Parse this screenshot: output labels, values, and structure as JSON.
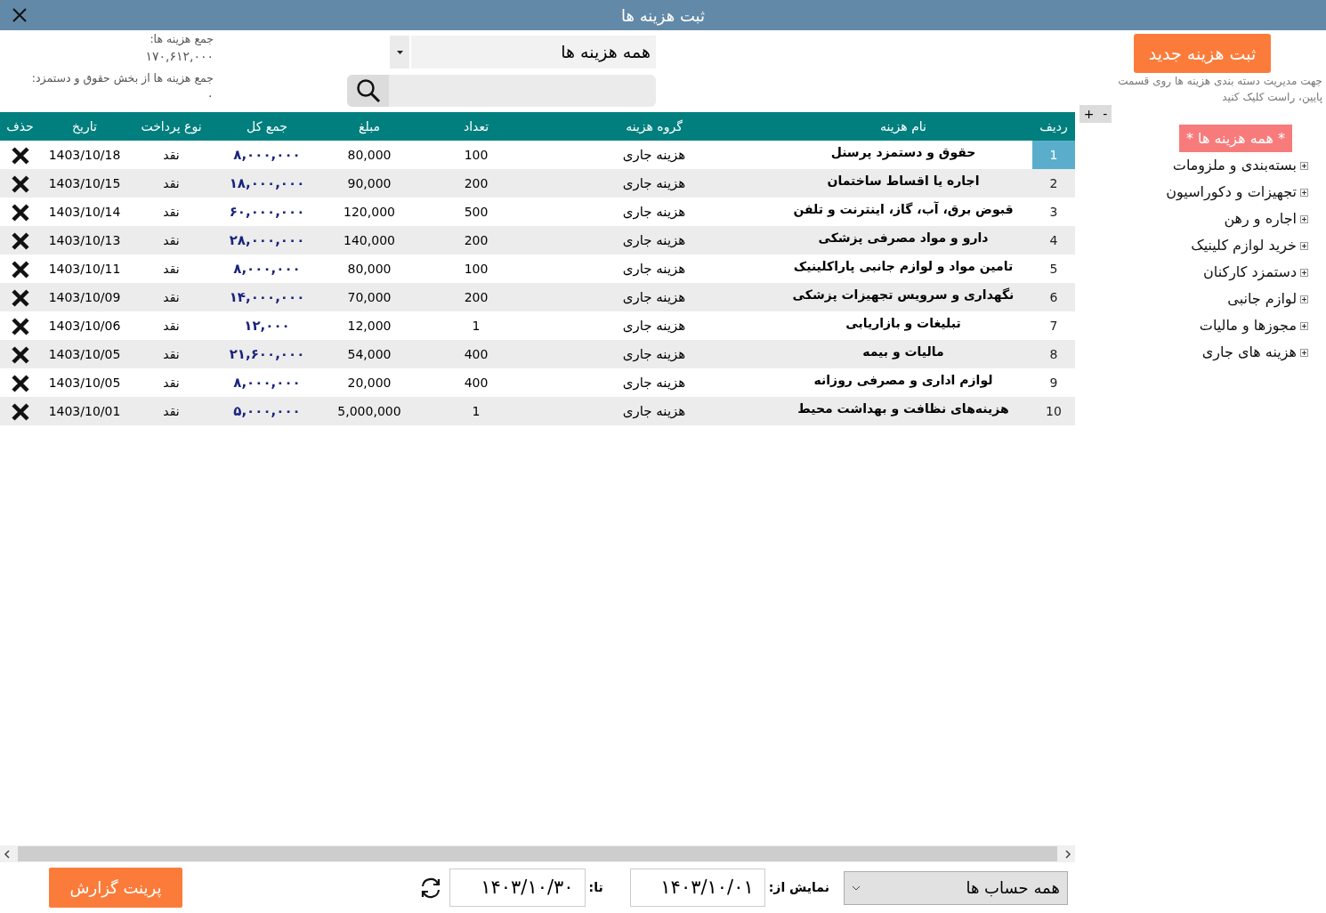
{
  "window": {
    "title": "ثبت هزینه ها"
  },
  "summary": [
    {
      "label": "جمع هزینه ها:",
      "value": "۱۷۰,۶۱۲,۰۰۰"
    },
    {
      "label": "جمع هزینه ها از بخش حقوق و دستمزد:",
      "value": "۰"
    }
  ],
  "filter": {
    "category": "همه هزینه ها"
  },
  "table": {
    "columns": [
      "ردیف",
      "نام هزینه",
      "گروه هزینه",
      "تعداد",
      "مبلغ",
      "جمع کل",
      "نوع پرداخت",
      "تاریخ",
      "حذف"
    ],
    "rows": [
      {
        "selected": true,
        "cells": [
          "1",
          "حقوق و دستمزد پرسنل",
          "هزینه جاری",
          "100",
          "80,000",
          "۸,۰۰۰,۰۰۰",
          "نقد",
          "1403/10/18"
        ]
      },
      {
        "selected": false,
        "cells": [
          "2",
          "اجاره یا اقساط ساختمان",
          "هزینه جاری",
          "200",
          "90,000",
          "۱۸,۰۰۰,۰۰۰",
          "نقد",
          "1403/10/15"
        ]
      },
      {
        "selected": false,
        "cells": [
          "3",
          "قبوض برق، آب، گاز، اینترنت و تلفن",
          "هزینه جاری",
          "500",
          "120,000",
          "۶۰,۰۰۰,۰۰۰",
          "نقد",
          "1403/10/14"
        ]
      },
      {
        "selected": false,
        "cells": [
          "4",
          "دارو و مواد مصرفی پزشکی",
          "هزینه جاری",
          "200",
          "140,000",
          "۲۸,۰۰۰,۰۰۰",
          "نقد",
          "1403/10/13"
        ]
      },
      {
        "selected": false,
        "cells": [
          "5",
          "تامین مواد و لوازم جانبی پاراکلینیک",
          "هزینه جاری",
          "100",
          "80,000",
          "۸,۰۰۰,۰۰۰",
          "نقد",
          "1403/10/11"
        ]
      },
      {
        "selected": false,
        "cells": [
          "6",
          "نگهداری و سرویس تجهیزات پزشکی",
          "هزینه جاری",
          "200",
          "70,000",
          "۱۴,۰۰۰,۰۰۰",
          "نقد",
          "1403/10/09"
        ]
      },
      {
        "selected": false,
        "cells": [
          "7",
          "تبلیغات و بازاریابی",
          "هزینه جاری",
          "1",
          "12,000",
          "۱۲,۰۰۰",
          "نقد",
          "1403/10/06"
        ]
      },
      {
        "selected": false,
        "cells": [
          "8",
          "مالیات و بیمه",
          "هزینه جاری",
          "400",
          "54,000",
          "۲۱,۶۰۰,۰۰۰",
          "نقد",
          "1403/10/05"
        ]
      },
      {
        "selected": false,
        "cells": [
          "9",
          "لوازم اداری و مصرفی روزانه",
          "هزینه جاری",
          "400",
          "20,000",
          "۸,۰۰۰,۰۰۰",
          "نقد",
          "1403/10/05"
        ]
      },
      {
        "selected": false,
        "cells": [
          "10",
          "هزینه‌های نظافت و بهداشت محیط",
          "هزینه جاری",
          "1",
          "5,000,000",
          "۵,۰۰۰,۰۰۰",
          "نقد",
          "1403/10/01"
        ]
      }
    ]
  },
  "sidebar": {
    "new_button": "ثبت هزینه جدید",
    "hint": "جهت مدیریت دسته بندی هزینه ها روی قسمت پایین، راست کلیک کنید",
    "expand_button": "+",
    "collapse_button": "-",
    "tree": {
      "label": "* همه هزینه ها *",
      "selected": true,
      "children": [
        {
          "label": "بسته‌بندی و ملزومات",
          "selected": false
        },
        {
          "label": "تجهیزات و دکوراسیون",
          "selected": false
        },
        {
          "label": "اجاره و رهن",
          "selected": false
        },
        {
          "label": "خرید لوازم کلینیک",
          "selected": false
        },
        {
          "label": "دستمزد کارکنان",
          "selected": false
        },
        {
          "label": "لوازم جانبی",
          "selected": false
        },
        {
          "label": "مجوزها و مالیات",
          "selected": false
        },
        {
          "label": "هزینه های جاری",
          "selected": false
        }
      ]
    }
  },
  "footer": {
    "account": "همه حساب ها",
    "from_label": "نمایش از:",
    "from_date": "۱۴۰۳/۱۰/۰۱",
    "to_label": "تا:",
    "to_date": "۱۴۰۳/۱۰/۳۰",
    "print_button": "پرینت گزارش"
  }
}
